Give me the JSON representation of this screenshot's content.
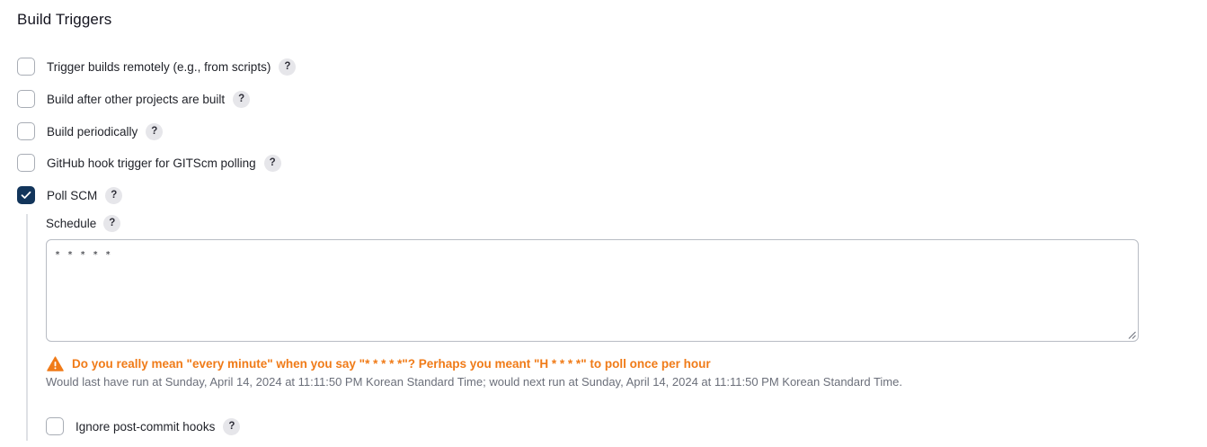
{
  "section": {
    "title": "Build Triggers"
  },
  "triggers": [
    {
      "label": "Trigger builds remotely (e.g., from scripts)",
      "checked": false,
      "help": "?"
    },
    {
      "label": "Build after other projects are built",
      "checked": false,
      "help": "?"
    },
    {
      "label": "Build periodically",
      "checked": false,
      "help": "?"
    },
    {
      "label": "GitHub hook trigger for GITScm polling",
      "checked": false,
      "help": "?"
    },
    {
      "label": "Poll SCM",
      "checked": true,
      "help": "?"
    }
  ],
  "poll_scm": {
    "schedule_label": "Schedule",
    "schedule_help": "?",
    "schedule_value": "* * * * *",
    "warning": "Do you really mean \"every minute\" when you say \"* * * * *\"? Perhaps you meant \"H * * * *\" to poll once per hour",
    "run_info": "Would last have run at Sunday, April 14, 2024 at 11:11:50 PM Korean Standard Time; would next run at Sunday, April 14, 2024 at 11:11:50 PM Korean Standard Time.",
    "ignore_hooks_label": "Ignore post-commit hooks",
    "ignore_hooks_checked": false,
    "ignore_hooks_help": "?"
  },
  "colors": {
    "accent": "#12355b",
    "warning": "#f07b18",
    "muted_text": "#6b6f7a"
  },
  "icons": {
    "check": "check-icon",
    "warning": "warning-triangle-icon",
    "help": "help-icon",
    "resize": "resize-grip-icon"
  }
}
